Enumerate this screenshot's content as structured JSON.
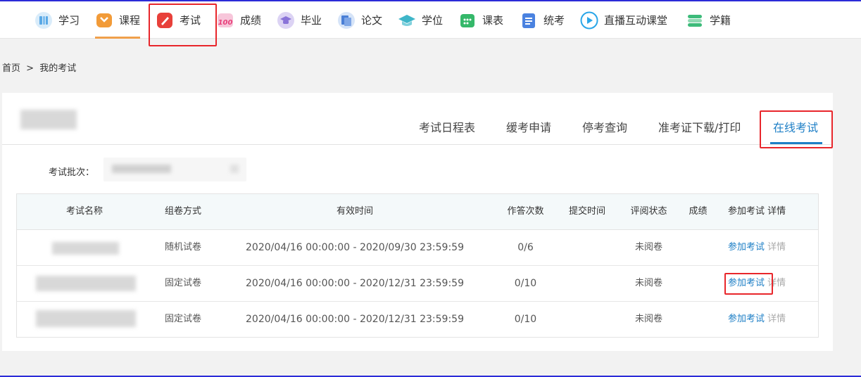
{
  "nav": {
    "items": [
      {
        "label": "学习",
        "icon": "study-icon",
        "color": "#5aa9e6"
      },
      {
        "label": "课程",
        "icon": "course-icon",
        "color": "#f29b38"
      },
      {
        "label": "考试",
        "icon": "exam-icon",
        "color": "#e8403a"
      },
      {
        "label": "成绩",
        "icon": "score-icon",
        "color": "#e8407a"
      },
      {
        "label": "毕业",
        "icon": "graduation-icon",
        "color": "#8a73d8"
      },
      {
        "label": "论文",
        "icon": "paper-icon",
        "color": "#4a7fd6"
      },
      {
        "label": "学位",
        "icon": "degree-icon",
        "color": "#3fb6c9"
      },
      {
        "label": "课表",
        "icon": "timetable-icon",
        "color": "#35b86a"
      },
      {
        "label": "统考",
        "icon": "unified-exam-icon",
        "color": "#4a82e0"
      },
      {
        "label": "直播互动课堂",
        "icon": "live-class-icon",
        "color": "#2aa6e8"
      },
      {
        "label": "学籍",
        "icon": "student-status-icon",
        "color": "#3dbb7a"
      }
    ],
    "active_index": 1,
    "highlighted_index": 2
  },
  "breadcrumb": {
    "home": "首页",
    "separator": ">",
    "current": "我的考试"
  },
  "tabs": [
    {
      "label": "考试日程表"
    },
    {
      "label": "缓考申请"
    },
    {
      "label": "停考查询"
    },
    {
      "label": "准考证下载/打印"
    },
    {
      "label": "在线考试"
    }
  ],
  "active_tab_index": 4,
  "filter": {
    "batch_label": "考试批次："
  },
  "table": {
    "headers": {
      "name": "考试名称",
      "mode": "组卷方式",
      "time": "有效时间",
      "attempts": "作答次数",
      "submit_time": "提交时间",
      "review_status": "评阅状态",
      "score": "成绩",
      "join": "参加考试",
      "detail": "详情"
    },
    "rows": [
      {
        "mode": "随机试卷",
        "time": "2020/04/16 00:00:00 - 2020/09/30 23:59:59",
        "attempts": "0/6",
        "submit_time": "",
        "review_status": "未阅卷",
        "score": "",
        "join": "参加考试",
        "detail": "详情"
      },
      {
        "mode": "固定试卷",
        "time": "2020/04/16 00:00:00 - 2020/12/31 23:59:59",
        "attempts": "0/10",
        "submit_time": "",
        "review_status": "未阅卷",
        "score": "",
        "join": "参加考试",
        "detail": "详情"
      },
      {
        "mode": "固定试卷",
        "time": "2020/04/16 00:00:00 - 2020/12/31 23:59:59",
        "attempts": "0/10",
        "submit_time": "",
        "review_status": "未阅卷",
        "score": "",
        "join": "参加考试",
        "detail": "详情"
      }
    ]
  },
  "colors": {
    "accent_blue": "#1e7fc6",
    "highlight_red": "#e8262b",
    "nav_active": "#f0a04b"
  }
}
